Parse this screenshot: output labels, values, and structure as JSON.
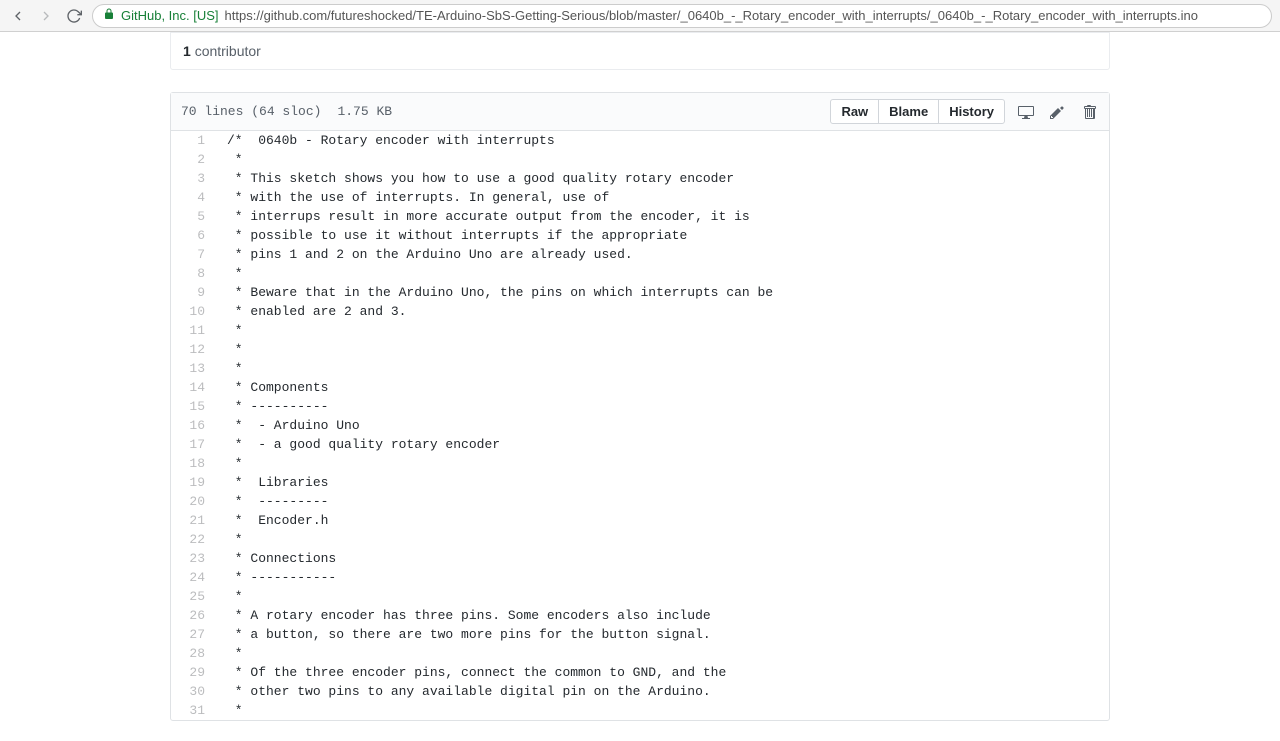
{
  "browser": {
    "orgLabel": "GitHub, Inc. [US]",
    "url": "https://github.com/futureshocked/TE-Arduino-SbS-Getting-Serious/blob/master/_0640b_-_Rotary_encoder_with_interrupts/_0640b_-_Rotary_encoder_with_interrupts.ino"
  },
  "contributors": {
    "count": 1,
    "label": "contributor"
  },
  "fileMeta": {
    "lines": "70 lines (64 sloc)",
    "size": "1.75 KB"
  },
  "actions": {
    "raw": "Raw",
    "blame": "Blame",
    "history": "History"
  },
  "code": [
    "/*  0640b - Rotary encoder with interrupts",
    " * ",
    " * This sketch shows you how to use a good quality rotary encoder",
    " * with the use of interrupts. In general, use of ",
    " * interrups result in more accurate output from the encoder, it is",
    " * possible to use it without interrupts if the appropriate ",
    " * pins 1 and 2 on the Arduino Uno are already used.",
    " * ",
    " * Beware that in the Arduino Uno, the pins on which interrupts can be",
    " * enabled are 2 and 3.",
    " * ",
    " * ",
    " * ",
    " * Components",
    " * ----------",
    " *  - Arduino Uno",
    " *  - a good quality rotary encoder",
    " *  ",
    " *  Libraries",
    " *  ---------",
    " *  Encoder.h",
    " *",
    " * Connections",
    " * -----------",
    " *  ",
    " * A rotary encoder has three pins. Some encoders also include ",
    " * a button, so there are two more pins for the button signal.",
    " * ",
    " * Of the three encoder pins, connect the common to GND, and the ",
    " * other two pins to any available digital pin on the Arduino.",
    " * "
  ]
}
